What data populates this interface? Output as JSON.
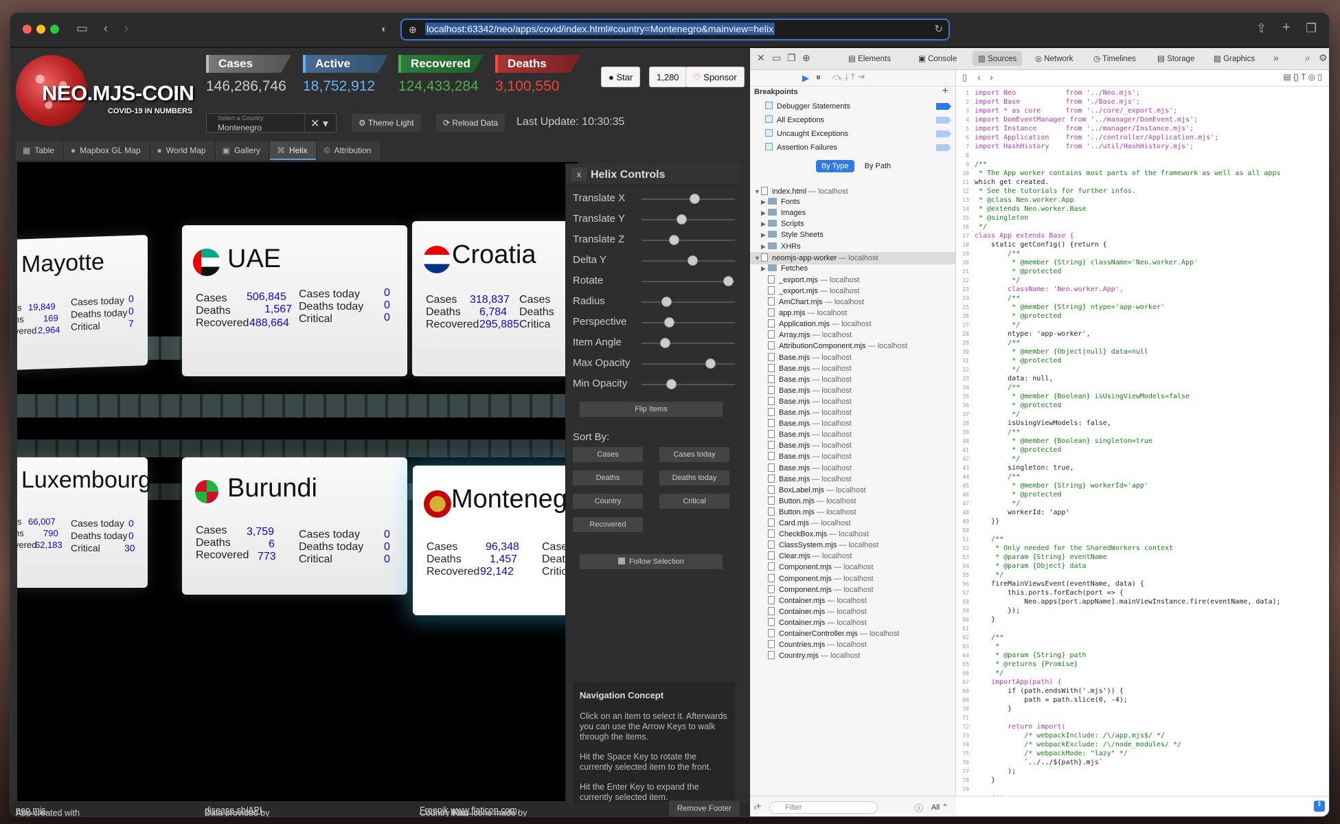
{
  "browser": {
    "url": "localhost:63342/neo/apps/covid/index.html#country=Montenegro&mainview=helix"
  },
  "header": {
    "logo_title": "NEO.MJS-COIN",
    "logo_subtitle": "COVID-19 IN NUMBERS",
    "stats": [
      {
        "label": "Cases",
        "value": "146,286,746"
      },
      {
        "label": "Active",
        "value": "18,752,912"
      },
      {
        "label": "Recovered",
        "value": "124,433,284"
      },
      {
        "label": "Deaths",
        "value": "3,100,550"
      }
    ],
    "country_select": {
      "label": "Select a Country",
      "value": "Montenegro"
    },
    "theme_button": "Theme Light",
    "reload_button": "Reload Data",
    "last_update": "Last Update: 10:30:35",
    "github_star": "Star",
    "github_count": "1,280",
    "sponsor": "Sponsor"
  },
  "tabs": [
    {
      "label": "Table",
      "icon": "table-icon"
    },
    {
      "label": "Mapbox GL Map",
      "icon": "globe-icon"
    },
    {
      "label": "World Map",
      "icon": "globe-icon"
    },
    {
      "label": "Gallery",
      "icon": "images-icon"
    },
    {
      "label": "Helix",
      "icon": "dna-icon"
    },
    {
      "label": "Attribution",
      "icon": "copyright-icon"
    }
  ],
  "cards": [
    {
      "name": "Mayotte",
      "cases": "19,849",
      "deaths": "169",
      "recovered": "2,964",
      "cases_today": "0",
      "deaths_today": "0",
      "critical": "7"
    },
    {
      "name": "UAE",
      "cases": "506,845",
      "deaths": "1,567",
      "recovered": "488,664",
      "cases_today": "0",
      "deaths_today": "0",
      "critical": "0"
    },
    {
      "name": "Croatia",
      "cases": "318,837",
      "deaths": "6,784",
      "recovered": "295,885"
    },
    {
      "name": "Luxembourg",
      "cases": "66,007",
      "deaths": "790",
      "recovered": "62,183",
      "cases_today": "0",
      "deaths_today": "0",
      "critical": "30"
    },
    {
      "name": "Burundi",
      "cases": "3,759",
      "deaths": "6",
      "recovered": "773",
      "cases_today": "0",
      "deaths_today": "0",
      "critical": "0"
    },
    {
      "name": "Montenegro",
      "cases": "96,348",
      "deaths": "1,457",
      "recovered": "92,142"
    }
  ],
  "card_labels": {
    "cases": "Cases",
    "deaths": "Deaths",
    "recovered": "Recovered",
    "cases_today": "Cases today",
    "deaths_today": "Deaths today",
    "critical": "Critical",
    "cases_trunc": "Case",
    "deaths_trunc": "Death",
    "critical_trunc": "Critica",
    "croatia_cases_trunc": "Cases",
    "croatia_deaths_trunc": "Deaths",
    "croatia_critical_trunc": "Critica",
    "montenegro_visible": "Monteneg",
    "mayotte_cases_trunc": "s",
    "mayotte_deaths_trunc": "hs",
    "mayotte_rec_trunc": "vered",
    "lux_cases_trunc": "s",
    "lux_deaths_trunc": "hs",
    "lux_rec_trunc": "vered"
  },
  "controls": {
    "title": "Helix Controls",
    "close": "x",
    "sliders": [
      {
        "label": "Translate X",
        "value": 0.58
      },
      {
        "label": "Translate Y",
        "value": 0.42
      },
      {
        "label": "Translate Z",
        "value": 0.33
      },
      {
        "label": "Delta Y",
        "value": 0.55
      },
      {
        "label": "Rotate",
        "value": 0.98
      },
      {
        "label": "Radius",
        "value": 0.24
      },
      {
        "label": "Perspective",
        "value": 0.27
      },
      {
        "label": "Item Angle",
        "value": 0.22
      },
      {
        "label": "Max Opacity",
        "value": 0.77
      },
      {
        "label": "Min Opacity",
        "value": 0.3
      }
    ],
    "flip_items": "Flip Items",
    "sort_by": "Sort By:",
    "sort_buttons": [
      "Cases",
      "Cases today",
      "Deaths",
      "Deaths today",
      "Country",
      "Critical",
      "Recovered"
    ],
    "follow_selection": "Follow Selection",
    "nav_title": "Navigation Concept",
    "nav_p1": "Click on an item to select it. Afterwards you can use the Arrow Keys to walk through the items.",
    "nav_p2": "Hit the Space Key to rotate the currently selected item to the front.",
    "nav_p3": "Hit the Enter Key to expand the currently selected item."
  },
  "footer": {
    "app_created": "App created with",
    "neo_link": "neo.mjs",
    "data_provided": "Data provided by",
    "disease_link": "disease.sh/API",
    "flag_icons": "Country Flag Icons made by",
    "freepik": "Freepik",
    "from": "from",
    "flaticon": "www.flaticon.com",
    "remove_footer": "Remove Footer"
  },
  "devtools": {
    "tabs": [
      "Elements",
      "Console",
      "Sources",
      "Network",
      "Timelines",
      "Storage",
      "Graphics"
    ],
    "active_tab": "Sources",
    "breakpoints_title": "Breakpoints",
    "breakpoints": [
      "Debugger Statements",
      "All Exceptions",
      "Uncaught Exceptions",
      "Assertion Failures"
    ],
    "by_type": "By Type",
    "by_path": "By Path",
    "tree": [
      {
        "name": "index.html",
        "host": "localhost",
        "kind": "file",
        "indent": 0,
        "arrow": "▼"
      },
      {
        "name": "Fonts",
        "kind": "dir",
        "indent": 1,
        "arrow": "▶"
      },
      {
        "name": "Images",
        "kind": "dir",
        "indent": 1,
        "arrow": "▶"
      },
      {
        "name": "Scripts",
        "kind": "dir",
        "indent": 1,
        "arrow": "▶"
      },
      {
        "name": "Style Sheets",
        "kind": "dir",
        "indent": 1,
        "arrow": "▶"
      },
      {
        "name": "XHRs",
        "kind": "dir",
        "indent": 1,
        "arrow": "▶"
      },
      {
        "name": "neomjs-app-worker",
        "host": "localhost",
        "kind": "file",
        "indent": 0,
        "arrow": "▼"
      },
      {
        "name": "Fetches",
        "kind": "dir",
        "indent": 1,
        "arrow": "▶"
      },
      {
        "name": "_export.mjs",
        "host": "localhost",
        "kind": "file",
        "indent": 1
      },
      {
        "name": "_export.mjs",
        "host": "localhost",
        "kind": "file",
        "indent": 1
      },
      {
        "name": "AmChart.mjs",
        "host": "localhost",
        "kind": "file",
        "indent": 1
      },
      {
        "name": "app.mjs",
        "host": "localhost",
        "kind": "file",
        "indent": 1
      },
      {
        "name": "Application.mjs",
        "host": "localhost",
        "kind": "file",
        "indent": 1
      },
      {
        "name": "Array.mjs",
        "host": "localhost",
        "kind": "file",
        "indent": 1
      },
      {
        "name": "AttributionComponent.mjs",
        "host": "localhost",
        "kind": "file",
        "indent": 1
      },
      {
        "name": "Base.mjs",
        "host": "localhost",
        "kind": "file",
        "indent": 1
      },
      {
        "name": "Base.mjs",
        "host": "localhost",
        "kind": "file",
        "indent": 1
      },
      {
        "name": "Base.mjs",
        "host": "localhost",
        "kind": "file",
        "indent": 1
      },
      {
        "name": "Base.mjs",
        "host": "localhost",
        "kind": "file",
        "indent": 1
      },
      {
        "name": "Base.mjs",
        "host": "localhost",
        "kind": "file",
        "indent": 1
      },
      {
        "name": "Base.mjs",
        "host": "localhost",
        "kind": "file",
        "indent": 1
      },
      {
        "name": "Base.mjs",
        "host": "localhost",
        "kind": "file",
        "indent": 1
      },
      {
        "name": "Base.mjs",
        "host": "localhost",
        "kind": "file",
        "indent": 1
      },
      {
        "name": "Base.mjs",
        "host": "localhost",
        "kind": "file",
        "indent": 1
      },
      {
        "name": "Base.mjs",
        "host": "localhost",
        "kind": "file",
        "indent": 1
      },
      {
        "name": "Base.mjs",
        "host": "localhost",
        "kind": "file",
        "indent": 1
      },
      {
        "name": "Base.mjs",
        "host": "localhost",
        "kind": "file",
        "indent": 1
      },
      {
        "name": "BoxLabel.mjs",
        "host": "localhost",
        "kind": "file",
        "indent": 1
      },
      {
        "name": "Button.mjs",
        "host": "localhost",
        "kind": "file",
        "indent": 1
      },
      {
        "name": "Button.mjs",
        "host": "localhost",
        "kind": "file",
        "indent": 1
      },
      {
        "name": "Card.mjs",
        "host": "localhost",
        "kind": "file",
        "indent": 1
      },
      {
        "name": "CheckBox.mjs",
        "host": "localhost",
        "kind": "file",
        "indent": 1
      },
      {
        "name": "ClassSystem.mjs",
        "host": "localhost",
        "kind": "file",
        "indent": 1
      },
      {
        "name": "Clear.mjs",
        "host": "localhost",
        "kind": "file",
        "indent": 1
      },
      {
        "name": "Component.mjs",
        "host": "localhost",
        "kind": "file",
        "indent": 1
      },
      {
        "name": "Component.mjs",
        "host": "localhost",
        "kind": "file",
        "indent": 1
      },
      {
        "name": "Component.mjs",
        "host": "localhost",
        "kind": "file",
        "indent": 1
      },
      {
        "name": "Container.mjs",
        "host": "localhost",
        "kind": "file",
        "indent": 1
      },
      {
        "name": "Container.mjs",
        "host": "localhost",
        "kind": "file",
        "indent": 1
      },
      {
        "name": "Container.mjs",
        "host": "localhost",
        "kind": "file",
        "indent": 1
      },
      {
        "name": "ContainerController.mjs",
        "host": "localhost",
        "kind": "file",
        "indent": 1
      },
      {
        "name": "Countries.mjs",
        "host": "localhost",
        "kind": "file",
        "indent": 1
      },
      {
        "name": "Country.mjs",
        "host": "localhost",
        "kind": "file",
        "indent": 1
      }
    ],
    "filter_placeholder": "Filter",
    "filter_all": "All",
    "code": [
      "import Neo            from '../Neo.mjs';",
      "import Base           from './Base.mjs';",
      "import * as core      from '../core/_export.mjs';",
      "import DomEventManager from '../manager/DomEvent.mjs';",
      "import Instance       from '../manager/Instance.mjs';",
      "import Application    from '../controller/Application.mjs';",
      "import HashHistory    from '../util/HashHistory.mjs';",
      "",
      "/**",
      " * The App worker contains most parts of the framework as well as all apps",
      "which get created.",
      " * See the tutorials for further infos.",
      " * @class Neo.worker.App",
      " * @extends Neo.worker.Base",
      " * @singleton",
      " */",
      "class App extends Base {",
      "    static getConfig() {return {",
      "        /**",
      "         * @member {String} className='Neo.worker.App'",
      "         * @protected",
      "         */",
      "        className: 'Neo.worker.App',",
      "        /**",
      "         * @member {String} ntype='app-worker'",
      "         * @protected",
      "         */",
      "        ntype: 'app-worker',",
      "        /**",
      "         * @member {Object|null} data=null",
      "         * @protected",
      "         */",
      "        data: null,",
      "        /**",
      "         * @member {Boolean} isUsingViewModels=false",
      "         * @protected",
      "         */",
      "        isUsingViewModels: false,",
      "        /**",
      "         * @member {Boolean} singleton=true",
      "         * @protected",
      "         */",
      "        singleton: true,",
      "        /**",
      "         * @member {String} workerId='app'",
      "         * @protected",
      "         */",
      "        workerId: 'app'",
      "    }}",
      "",
      "    /**",
      "     * Only needed for the SharedWorkers context",
      "     * @param {String} eventName",
      "     * @param {Object} data",
      "     */",
      "    fireMainViewsEvent(eventName, data) {",
      "        this.ports.forEach(port => {",
      "            Neo.apps[port.appName].mainViewInstance.fire(eventName, data);",
      "        });",
      "    }",
      "",
      "    /**",
      "     *",
      "     * @param {String} path",
      "     * @returns {Promise}",
      "     */",
      "    importApp(path) {",
      "        if (path.endsWith('.mjs')) {",
      "            path = path.slice(0, -4);",
      "        }",
      "",
      "        return import(",
      "            /* webpackInclude: /\\/app.mjs$/ */",
      "            /* webpackExclude: /\\/node_modules/ */",
      "            /* webpackMode: \"lazy\" */",
      "            `../../${path}.mjs`",
      "        );",
      "    }",
      "",
      "    /**"
    ]
  }
}
